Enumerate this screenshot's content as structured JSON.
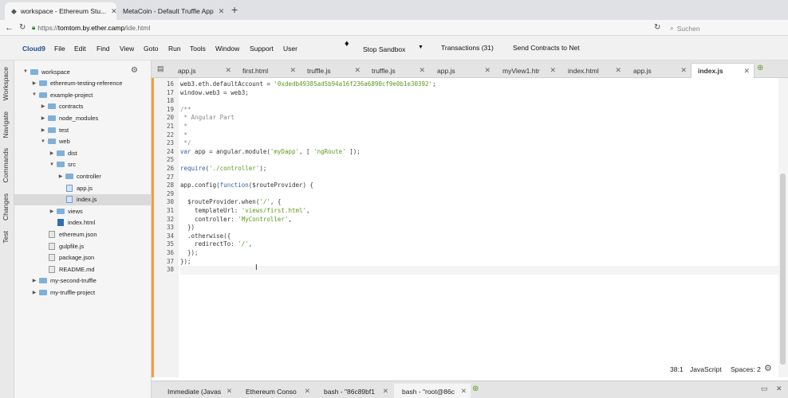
{
  "browser": {
    "tabs": [
      {
        "label": "workspace - Ethereum Stu..."
      },
      {
        "label": "MetaCoin - Default Truffle App"
      }
    ],
    "url": {
      "prefix": "https://",
      "host": "tomtom.by.ether.camp",
      "path": "/ide.html"
    },
    "search_placeholder": "Suchen"
  },
  "menu": {
    "brand": "Cloud9",
    "items": [
      "File",
      "Edit",
      "Find",
      "View",
      "Goto",
      "Run",
      "Tools",
      "Window",
      "Support",
      "User"
    ],
    "stop_sandbox": "Stop Sandbox",
    "transactions": "Transactions (31)",
    "send_contracts": "Send Contracts to Net"
  },
  "sidebar_tabs": [
    "Workspace",
    "Navigate",
    "Commands",
    "Changes",
    "Test"
  ],
  "tree": [
    {
      "label": "workspace",
      "depth": 0,
      "kind": "folder",
      "arrow": "▼"
    },
    {
      "label": "ethereum-testing-reference",
      "depth": 1,
      "kind": "folder",
      "arrow": "▶"
    },
    {
      "label": "example-project",
      "depth": 1,
      "kind": "folder",
      "arrow": "▼"
    },
    {
      "label": "contracts",
      "depth": 2,
      "kind": "folder",
      "arrow": "▶"
    },
    {
      "label": "node_modules",
      "depth": 2,
      "kind": "folder",
      "arrow": "▶"
    },
    {
      "label": "test",
      "depth": 2,
      "kind": "folder",
      "arrow": "▶"
    },
    {
      "label": "web",
      "depth": 2,
      "kind": "folder",
      "arrow": "▼"
    },
    {
      "label": "dist",
      "depth": 3,
      "kind": "folder",
      "arrow": "▶"
    },
    {
      "label": "src",
      "depth": 3,
      "kind": "folder",
      "arrow": "▼"
    },
    {
      "label": "controller",
      "depth": 4,
      "kind": "folder",
      "arrow": "▶"
    },
    {
      "label": "app.js",
      "depth": 4,
      "kind": "js",
      "arrow": ""
    },
    {
      "label": "index.js",
      "depth": 4,
      "kind": "js",
      "arrow": "",
      "selected": true
    },
    {
      "label": "views",
      "depth": 3,
      "kind": "folder",
      "arrow": "▶"
    },
    {
      "label": "index.html",
      "depth": 3,
      "kind": "html",
      "arrow": ""
    },
    {
      "label": "ethereum.json",
      "depth": 2,
      "kind": "file",
      "arrow": ""
    },
    {
      "label": "gulpfile.js",
      "depth": 2,
      "kind": "file",
      "arrow": ""
    },
    {
      "label": "package.json",
      "depth": 2,
      "kind": "file",
      "arrow": ""
    },
    {
      "label": "README.md",
      "depth": 2,
      "kind": "file",
      "arrow": ""
    },
    {
      "label": "my-second-truffle",
      "depth": 1,
      "kind": "folder",
      "arrow": "▶"
    },
    {
      "label": "my-truffle-project",
      "depth": 1,
      "kind": "folder",
      "arrow": "▶"
    }
  ],
  "editor_tabs": [
    {
      "label": "app.js"
    },
    {
      "label": "first.html"
    },
    {
      "label": "truffle.js"
    },
    {
      "label": "truffle.js"
    },
    {
      "label": "app.js"
    },
    {
      "label": "myView1.htr"
    },
    {
      "label": "index.html"
    },
    {
      "label": "app.js"
    },
    {
      "label": "index.js",
      "active": true
    }
  ],
  "code": [
    {
      "n": "16",
      "t": "web3.eth.defaultAccount = '0xdedb49385ad5b94a16f236a6890cf9e0b1e30392';"
    },
    {
      "n": "17",
      "t": "window.web3 = web3;"
    },
    {
      "n": "18",
      "t": ""
    },
    {
      "n": "19",
      "t": "/**"
    },
    {
      "n": "20",
      "t": " * Angular Part"
    },
    {
      "n": "21",
      "t": " *"
    },
    {
      "n": "22",
      "t": " *"
    },
    {
      "n": "23",
      "t": " */"
    },
    {
      "n": "24",
      "t": "var app = angular.module('myDapp', [ 'ngRoute' ]);"
    },
    {
      "n": "25",
      "t": ""
    },
    {
      "n": "26",
      "t": "require('./controller');"
    },
    {
      "n": "27",
      "t": ""
    },
    {
      "n": "28",
      "t": "app.config(function($routeProvider) {"
    },
    {
      "n": "29",
      "t": ""
    },
    {
      "n": "30",
      "t": "  $routeProvider.when('/', {"
    },
    {
      "n": "31",
      "t": "    templateUrl: 'views/first.html',"
    },
    {
      "n": "32",
      "t": "    controller: 'MyController',"
    },
    {
      "n": "33",
      "t": "  })"
    },
    {
      "n": "34",
      "t": "  .otherwise({"
    },
    {
      "n": "35",
      "t": "    redirectTo: '/',"
    },
    {
      "n": "36",
      "t": "  });"
    },
    {
      "n": "37",
      "t": "});"
    },
    {
      "n": "38",
      "t": "",
      "current": true
    }
  ],
  "status": {
    "position": "38:1",
    "language": "JavaScript",
    "spaces": "Spaces: 2"
  },
  "console_tabs": [
    {
      "label": "Immediate (Javas"
    },
    {
      "label": "Ethereum Conso"
    },
    {
      "label": "bash - \"86c89bf1"
    },
    {
      "label": "bash - \"root@86c",
      "active": true
    }
  ],
  "colors": {
    "accent": "#f0a040",
    "string": "#5a9a1e",
    "comment": "#8a8a8a",
    "keyword": "#2f5fa6"
  }
}
